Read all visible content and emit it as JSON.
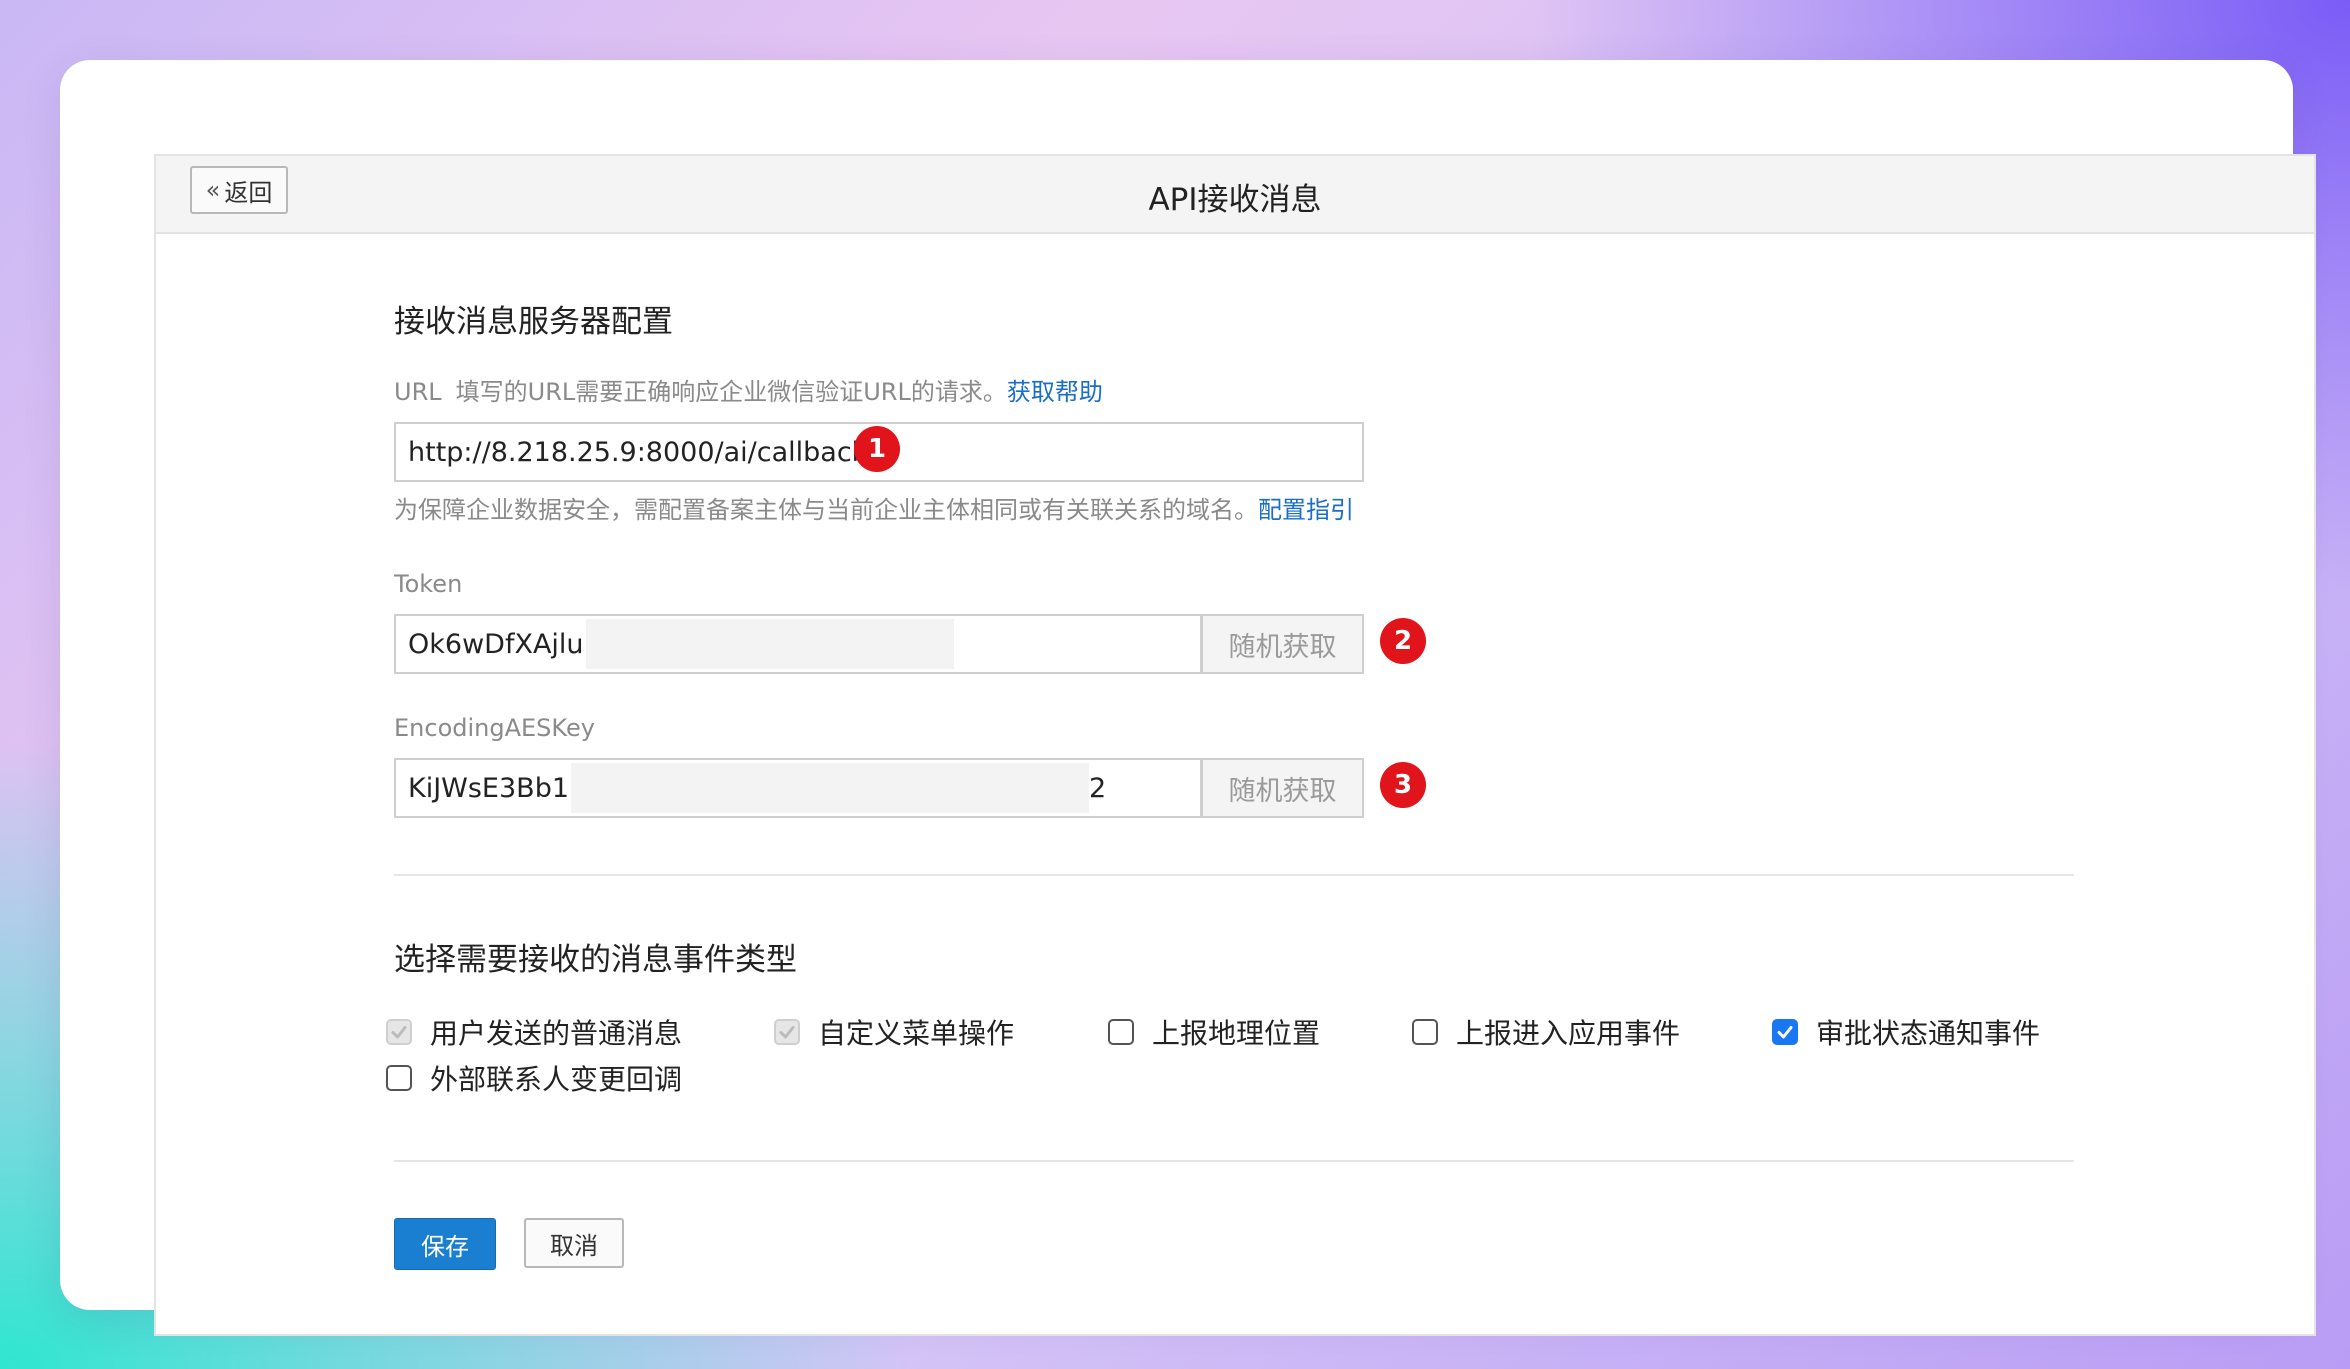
{
  "header": {
    "back_label": "返回",
    "title": "API接收消息"
  },
  "server_config": {
    "section_title": "接收消息服务器配置",
    "url": {
      "label": "URL",
      "description": "填写的URL需要正确响应企业微信验证URL的请求。",
      "help_link": "获取帮助",
      "value": "http://8.218.25.9:8000/ai/callback",
      "badge": "1",
      "hint": "为保障企业数据安全，需配置备案主体与当前企业主体相同或有关联关系的域名。",
      "hint_link": "配置指引"
    },
    "token": {
      "label": "Token",
      "value": "Ok6wDfXAjlu",
      "random_button": "随机获取",
      "badge": "2"
    },
    "aes_key": {
      "label": "EncodingAESKey",
      "value": "KiJWsE3Bb1",
      "value_tail": "2",
      "random_button": "随机获取",
      "badge": "3"
    }
  },
  "events": {
    "section_title": "选择需要接收的消息事件类型",
    "options": [
      {
        "label": "用户发送的普通消息",
        "state": "checked-disabled"
      },
      {
        "label": "自定义菜单操作",
        "state": "checked-disabled"
      },
      {
        "label": "上报地理位置",
        "state": "unchecked"
      },
      {
        "label": "上报进入应用事件",
        "state": "unchecked"
      },
      {
        "label": "审批状态通知事件",
        "state": "checked"
      },
      {
        "label": "外部联系人变更回调",
        "state": "unchecked"
      }
    ]
  },
  "actions": {
    "save_label": "保存",
    "cancel_label": "取消"
  },
  "colors": {
    "primary": "#1b7fd1",
    "link": "#1a6ec7",
    "badge": "#e0141a",
    "checkbox_checked": "#1877f2"
  }
}
